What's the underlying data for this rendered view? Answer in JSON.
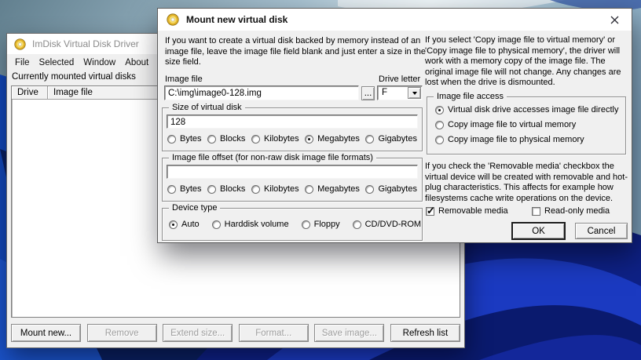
{
  "wallpaper": {
    "sky_left": "#62808f",
    "sky_light": "#dcebf2",
    "sky_right": "#7fa3bd",
    "navy_dark": "#0a1243",
    "ribbon_bright": "#1b3ac1",
    "ribbon_mid": "#0e2186"
  },
  "main_window": {
    "title": "ImDisk Virtual Disk Driver",
    "menu": [
      "File",
      "Selected",
      "Window",
      "About"
    ],
    "mounted_label": "Currently mounted virtual disks",
    "columns": [
      "Drive",
      "Image file"
    ],
    "rows": [],
    "buttons": [
      {
        "label": "Mount new...",
        "enabled": true
      },
      {
        "label": "Remove",
        "enabled": false
      },
      {
        "label": "Extend size...",
        "enabled": false
      },
      {
        "label": "Format...",
        "enabled": false
      },
      {
        "label": "Save image...",
        "enabled": false
      },
      {
        "label": "Refresh list",
        "enabled": true
      }
    ]
  },
  "dialog": {
    "title": "Mount new virtual disk",
    "intro": "If you want to create a virtual disk backed by memory instead of an image file, leave the image file field blank and just enter a size in the size field.",
    "image_file": {
      "label": "Image file",
      "value": "C:\\img\\image0-128.img",
      "browse_label": "..."
    },
    "drive_letter": {
      "label": "Drive letter",
      "value": "F"
    },
    "units": [
      "Bytes",
      "Blocks",
      "Kilobytes",
      "Megabytes",
      "Gigabytes"
    ],
    "size_group": {
      "title": "Size of virtual disk",
      "value": "128",
      "selected_unit": "Megabytes"
    },
    "offset_group": {
      "title": "Image file offset (for non-raw disk image file formats)",
      "value": "",
      "selected_unit": null
    },
    "device_group": {
      "title": "Device type",
      "options": [
        "Auto",
        "Harddisk volume",
        "Floppy",
        "CD/DVD-ROM"
      ],
      "selected": "Auto"
    },
    "info_memory": "If you select 'Copy image file to virtual memory' or 'Copy image file to physical memory', the driver will work with a memory copy of the image file. The original image file will not change. Any changes are lost when the drive is dismounted.",
    "access_group": {
      "title": "Image file access",
      "options": [
        "Virtual disk drive accesses image file directly",
        "Copy image file to virtual memory",
        "Copy image file to physical memory"
      ],
      "selected": "Virtual disk drive accesses image file directly"
    },
    "info_removable": "If you check the 'Removable media' checkbox the virtual device will be created with removable and hot-plug characteristics. This affects for example how filesystems cache write operations on the device.",
    "checkboxes": [
      {
        "label": "Removable media",
        "checked": true
      },
      {
        "label": "Read-only media",
        "checked": false
      }
    ],
    "ok_label": "OK",
    "cancel_label": "Cancel"
  }
}
